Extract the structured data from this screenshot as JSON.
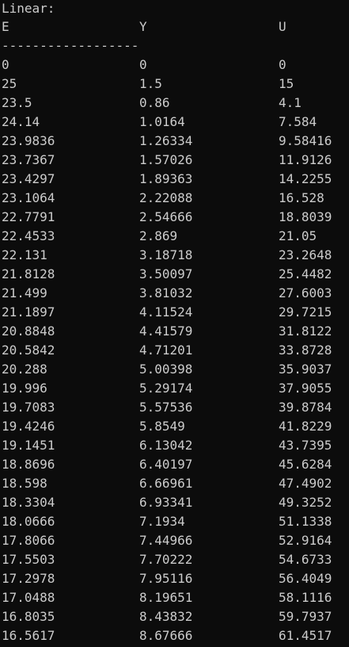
{
  "console": {
    "title": "Linear:",
    "headers": [
      "E",
      "Y",
      "U"
    ],
    "separator": "------------------",
    "rows": [
      [
        "0",
        "0",
        "0"
      ],
      [
        "25",
        "1.5",
        "15"
      ],
      [
        "23.5",
        "0.86",
        "4.1"
      ],
      [
        "24.14",
        "1.0164",
        "7.584"
      ],
      [
        "23.9836",
        "1.26334",
        "9.58416"
      ],
      [
        "23.7367",
        "1.57026",
        "11.9126"
      ],
      [
        "23.4297",
        "1.89363",
        "14.2255"
      ],
      [
        "23.1064",
        "2.22088",
        "16.528"
      ],
      [
        "22.7791",
        "2.54666",
        "18.8039"
      ],
      [
        "22.4533",
        "2.869",
        "21.05"
      ],
      [
        "22.131",
        "3.18718",
        "23.2648"
      ],
      [
        "21.8128",
        "3.50097",
        "25.4482"
      ],
      [
        "21.499",
        "3.81032",
        "27.6003"
      ],
      [
        "21.1897",
        "4.11524",
        "29.7215"
      ],
      [
        "20.8848",
        "4.41579",
        "31.8122"
      ],
      [
        "20.5842",
        "4.71201",
        "33.8728"
      ],
      [
        "20.288",
        "5.00398",
        "35.9037"
      ],
      [
        "19.996",
        "5.29174",
        "37.9055"
      ],
      [
        "19.7083",
        "5.57536",
        "39.8784"
      ],
      [
        "19.4246",
        "5.8549",
        "41.8229"
      ],
      [
        "19.1451",
        "6.13042",
        "43.7395"
      ],
      [
        "18.8696",
        "6.40197",
        "45.6284"
      ],
      [
        "18.598",
        "6.66961",
        "47.4902"
      ],
      [
        "18.3304",
        "6.93341",
        "49.3252"
      ],
      [
        "18.0666",
        "7.1934",
        "51.1338"
      ],
      [
        "17.8066",
        "7.44966",
        "52.9164"
      ],
      [
        "17.5503",
        "7.70222",
        "54.6733"
      ],
      [
        "17.2978",
        "7.95116",
        "56.4049"
      ],
      [
        "17.0488",
        "8.19651",
        "58.1116"
      ],
      [
        "16.8035",
        "8.43832",
        "59.7937"
      ],
      [
        "16.5617",
        "8.67666",
        "61.4517"
      ]
    ]
  },
  "colors": {
    "background": "#0c0c0c",
    "text": "#cccccc"
  }
}
